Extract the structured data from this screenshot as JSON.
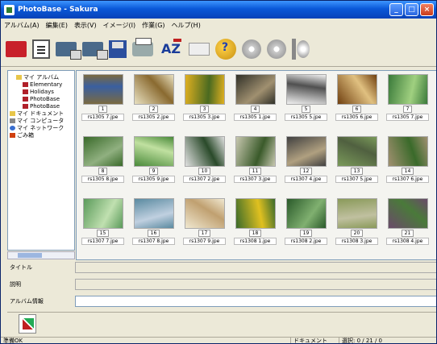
{
  "window": {
    "title": "PhotoBase - Sakura",
    "buttons": [
      "_",
      "□",
      "×"
    ]
  },
  "menu": [
    "アルバム(A)",
    "編集(E)",
    "表示(V)",
    "イメージ(I)",
    "作業(G)",
    "ヘルプ(H)"
  ],
  "toolbar": [
    "open",
    "doc",
    "scan",
    "scan2",
    "save",
    "print",
    "spell",
    "blank",
    "help",
    "cd",
    "cd2",
    "cd3"
  ],
  "tree": [
    {
      "label": "マイ アルバム",
      "icon": "folder",
      "indent": 1
    },
    {
      "label": "Elementary",
      "icon": "red",
      "indent": 2
    },
    {
      "label": "Holidays",
      "icon": "red",
      "indent": 2
    },
    {
      "label": "PhotoBase",
      "icon": "red",
      "indent": 2
    },
    {
      "label": "PhotoBase",
      "icon": "red",
      "indent": 2
    },
    {
      "label": "マイ ドキュメント",
      "icon": "folder",
      "indent": 0
    },
    {
      "label": "マイ コンピュータ",
      "icon": "drive",
      "indent": 0
    },
    {
      "label": "マイ ネットワーク",
      "icon": "globe",
      "indent": 0
    },
    {
      "label": "ごみ箱",
      "icon": "book",
      "indent": 0
    }
  ],
  "thumbnails": [
    {
      "n": "1",
      "file": "rs1305 7.jpe",
      "c1": "#7a6a40",
      "c2": "#3a5fa0"
    },
    {
      "n": "2",
      "file": "rs1305 2.jpe",
      "c1": "#e8e0c0",
      "c2": "#8a6a30"
    },
    {
      "n": "3",
      "file": "rs1305 3.jpe",
      "c1": "#e0b020",
      "c2": "#4a6a20"
    },
    {
      "n": "4",
      "file": "rs1305 1.jpe",
      "c1": "#303028",
      "c2": "#a09070"
    },
    {
      "n": "5",
      "file": "rs1305 5.jpe",
      "c1": "#f0f0f0",
      "c2": "#505050"
    },
    {
      "n": "6",
      "file": "rs1305 6.jpe",
      "c1": "#704010",
      "c2": "#e0c080"
    },
    {
      "n": "7",
      "file": "rs1305 7.jpe",
      "c1": "#3a7a3a",
      "c2": "#a0d080"
    },
    {
      "n": "8",
      "file": "rs1305 8.jpe",
      "c1": "#3a6a2a",
      "c2": "#90b080"
    },
    {
      "n": "9",
      "file": "rs1305 9.jpe",
      "c1": "#4a8a3a",
      "c2": "#c0e0a0"
    },
    {
      "n": "10",
      "file": "rs1307 2.jpe",
      "c1": "#e0e0e0",
      "c2": "#2a4a2a"
    },
    {
      "n": "11",
      "file": "rs1307 3.jpe",
      "c1": "#c8c8b0",
      "c2": "#3a5a2a"
    },
    {
      "n": "12",
      "file": "rs1307 4.jpe",
      "c1": "#404040",
      "c2": "#b0a080"
    },
    {
      "n": "13",
      "file": "rs1307 5.jpe",
      "c1": "#7a9a5a",
      "c2": "#506040"
    },
    {
      "n": "14",
      "file": "rs1307 6.jpe",
      "c1": "#a09070",
      "c2": "#3a6a2a"
    },
    {
      "n": "15",
      "file": "rs1307 7.jpe",
      "c1": "#5a9a5a",
      "c2": "#c0e0b0"
    },
    {
      "n": "16",
      "file": "rs1307 8.jpe",
      "c1": "#5a8aa0",
      "c2": "#c0d0e0"
    },
    {
      "n": "17",
      "file": "rs1307 9.jpe",
      "c1": "#f0e8d0",
      "c2": "#c0a070"
    },
    {
      "n": "18",
      "file": "rs1308 1.jpe",
      "c1": "#3a6a2a",
      "c2": "#e0c020"
    },
    {
      "n": "19",
      "file": "rs1308 2.jpe",
      "c1": "#2a5a2a",
      "c2": "#80b070"
    },
    {
      "n": "20",
      "file": "rs1308 3.jpe",
      "c1": "#8a9a5a",
      "c2": "#c0c0a0"
    },
    {
      "n": "21",
      "file": "rs1308 4.jpe",
      "c1": "#6a4a6a",
      "c2": "#4a7a3a"
    }
  ],
  "props": {
    "title_label": "タイトル",
    "memo_label": "説明",
    "album_label": "アルバム情報"
  },
  "status": {
    "left": "準備OK",
    "mid": "ドキュメント",
    "right": "選択: 0 / 21 / 0"
  }
}
